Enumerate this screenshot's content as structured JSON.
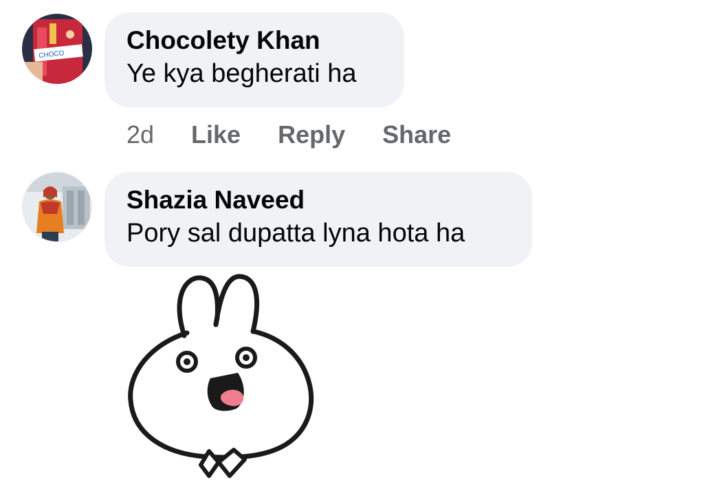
{
  "comments": [
    {
      "author": "Chocolety Khan",
      "text": "Ye kya begherati ha",
      "time": "2d",
      "actions": {
        "like": "Like",
        "reply": "Reply",
        "share": "Share"
      }
    },
    {
      "author": "Shazia Naveed",
      "text": "Pory sal dupatta lyna hota ha",
      "sticker": "bunny-sticker"
    }
  ],
  "colors": {
    "bubble": "#f0f2f5",
    "text": "#050505",
    "secondary": "#65676b"
  }
}
